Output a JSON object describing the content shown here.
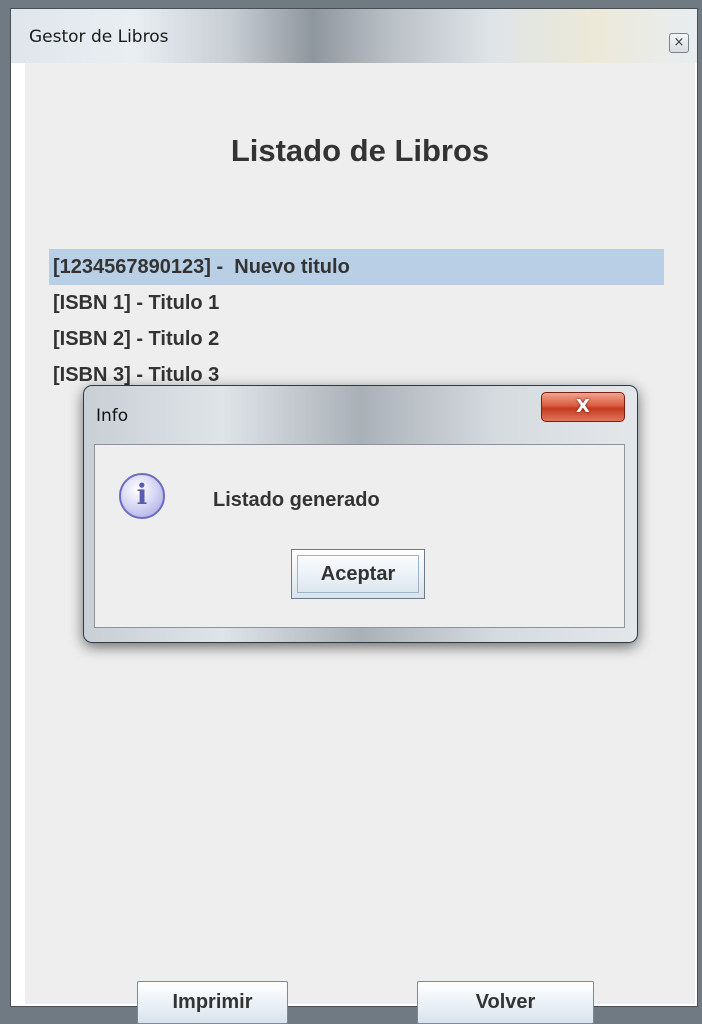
{
  "window": {
    "title": "Gestor de Libros",
    "close_glyph": "×"
  },
  "main": {
    "heading": "Listado de Libros",
    "list_items": [
      {
        "label": "[1234567890123] -  Nuevo titulo",
        "selected": true
      },
      {
        "label": "[ISBN 1] - Titulo 1",
        "selected": false
      },
      {
        "label": "[ISBN 2] - Titulo 2",
        "selected": false
      },
      {
        "label": "[ISBN 3] - Titulo 3",
        "selected": false
      }
    ],
    "print_button": "Imprimir",
    "back_button": "Volver"
  },
  "dialog": {
    "title": "Info",
    "close_glyph": "X",
    "icon": "info-icon",
    "icon_glyph": "i",
    "message": "Listado generado",
    "ok_button": "Aceptar"
  },
  "colors": {
    "selection": "#b8cfe5",
    "close_button": "#c33a20"
  }
}
